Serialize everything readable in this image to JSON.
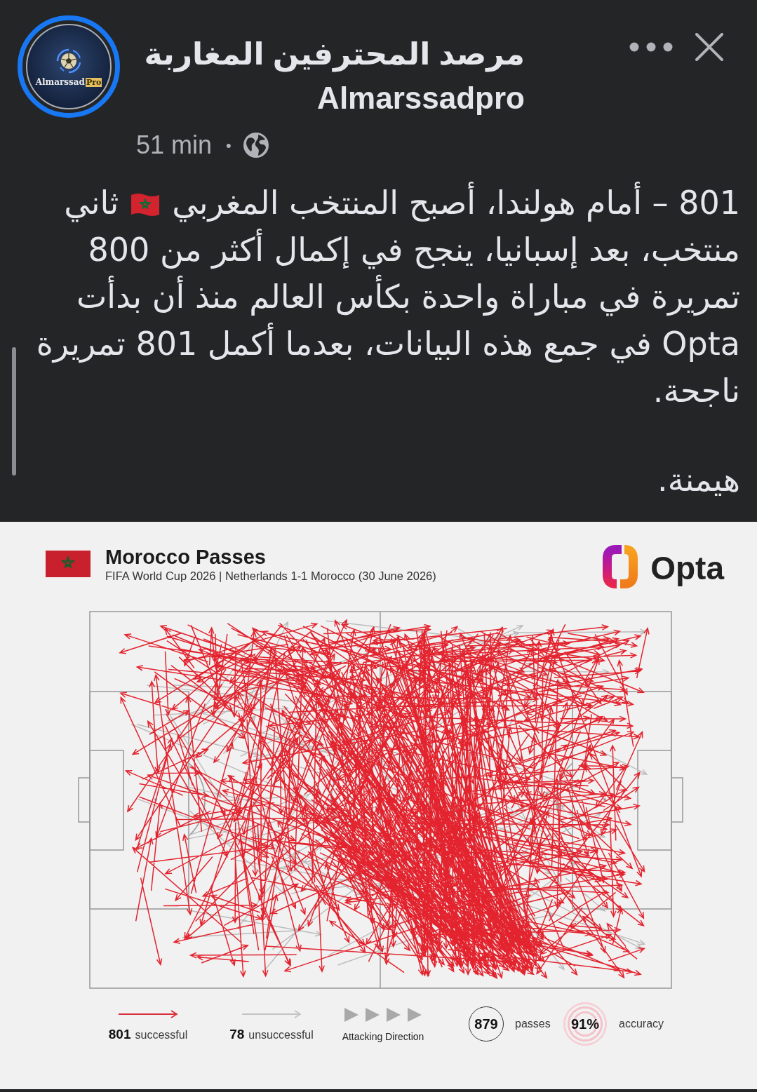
{
  "post": {
    "author": {
      "name_lines": [
        "مرصد المحترفين المغاربة",
        "Almarssadpro"
      ],
      "avatar_text": "Almarssad",
      "avatar_badge": "Pro"
    },
    "time": "51 min",
    "separator": "•",
    "text": {
      "before_flag": "801 – أمام هولندا، أصبح المنتخب المغربي",
      "after_flag": "ثاني",
      "continued": "منتخب، بعد إسبانيا، ينجح في إكمال أكثر من 800 تمريرة في مباراة واحدة بكأس العالم منذ أن بدأت Opta في جمع هذه البيانات، بعدما أكمل 801 تمريرة ناجحة."
    },
    "closing": "هيمنة."
  },
  "graphic": {
    "title": "Morocco Passes",
    "subtitle": "FIFA World Cup 2026 | Netherlands 1-1 Morocco (30 June 2026)",
    "brand": "Opta",
    "legend": {
      "successful": {
        "value": "801",
        "label": "successful"
      },
      "unsuccessful": {
        "value": "78",
        "label": "unsuccessful"
      },
      "direction": {
        "label": "Attacking Direction"
      },
      "total": {
        "value": "879",
        "label": "passes"
      },
      "accuracy": {
        "value": "91%",
        "label": "accuracy"
      }
    }
  }
}
